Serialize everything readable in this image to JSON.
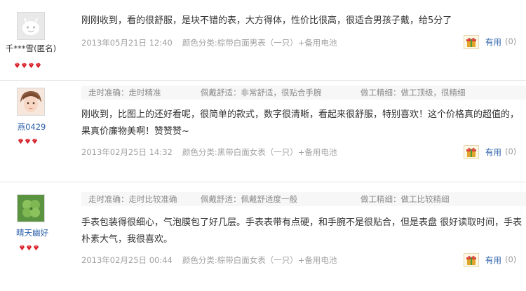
{
  "reviews": [
    {
      "username": "千***雪(匿名)",
      "avatar": "anonymous-face-icon",
      "tags": null,
      "content": "刚刚收到，看的很舒服，是块不错的表，大方得体，性价比很高，很适合男孩子戴，给5分了",
      "date": "2013年05月21日 12:40",
      "sku": "颜色分类:棕带白面男表（一只）+备用电池",
      "useful_label": "有用",
      "useful_count": "(0)"
    },
    {
      "username": "燕0429",
      "avatar": "user-photo",
      "tags": {
        "accuracy": "走时准确：走时精准",
        "comfort": "佩戴舒适：非常舒适，很贴合手腕",
        "craft": "做工精细：做工顶级，很精细"
      },
      "content": "刚收到，比图上的还好看呢，很简单的款式，数字很清晰，看起来很舒服，特别喜欢！这个价格真的超值的，果真价廉物美啊！赞赞赞~",
      "date": "2013年02月25日 14:32",
      "sku": "颜色分类:黑带白面女表（一只）+备用电池",
      "useful_label": "有用",
      "useful_count": "(0)"
    },
    {
      "username": "晴天幽好",
      "avatar": "clover-photo",
      "tags": {
        "accuracy": "走时准确：走时比较准确",
        "comfort": "佩戴舒适：佩戴舒适度一般",
        "craft": "做工精细：做工比较精细"
      },
      "content": "手表包装得很细心，气泡膜包了好几层。手表表带有点硬，和手腕不是很贴合，但是表盘 很好读取时间，手表朴素大气，我很喜欢。",
      "date": "2013年02月25日 00:44",
      "sku": "颜色分类:棕带白面女表（一只）+备用电池",
      "useful_label": "有用",
      "useful_count": "(0)"
    }
  ],
  "colors": {
    "link_blue": "#2a5fa8",
    "meta_gray": "#a0a0a0",
    "gem_red": "#d7212a",
    "tag_bg": "#f7f7f7"
  }
}
